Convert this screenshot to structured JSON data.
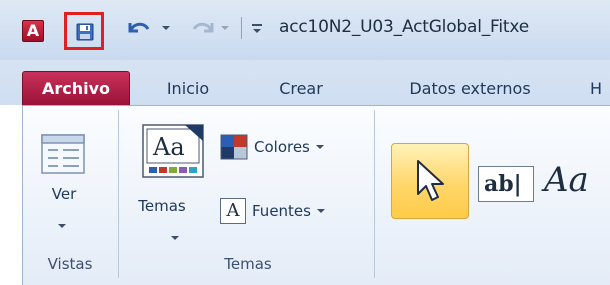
{
  "titlebar": {
    "app_icon_letter": "A",
    "document_title": "acc10N2_U03_ActGlobal_Fitxe",
    "qat": {
      "save_icon": "save-icon",
      "undo_icon": "undo-icon",
      "redo_icon": "redo-icon",
      "customize_icon": "customize-qat-icon"
    }
  },
  "tabs": {
    "archivo": "Archivo",
    "inicio": "Inicio",
    "crear": "Crear",
    "datos": "Datos externos",
    "more": "H"
  },
  "ribbon": {
    "vistas": {
      "ver_label": "Ver",
      "group_label": "Vistas"
    },
    "temas": {
      "temas_label": "Temas",
      "temas_icon_text": "Aa",
      "colores_label": "Colores",
      "fuentes_label": "Fuentes",
      "fuentes_icon_text": "A",
      "group_label": "Temas"
    },
    "controles": {
      "textbox_text": "ab|",
      "label_text": "Aa"
    }
  },
  "colors": {
    "archivo_tab": "#b0214a",
    "save_highlight": "#e0201f",
    "selected_control": "#ffd66b"
  }
}
